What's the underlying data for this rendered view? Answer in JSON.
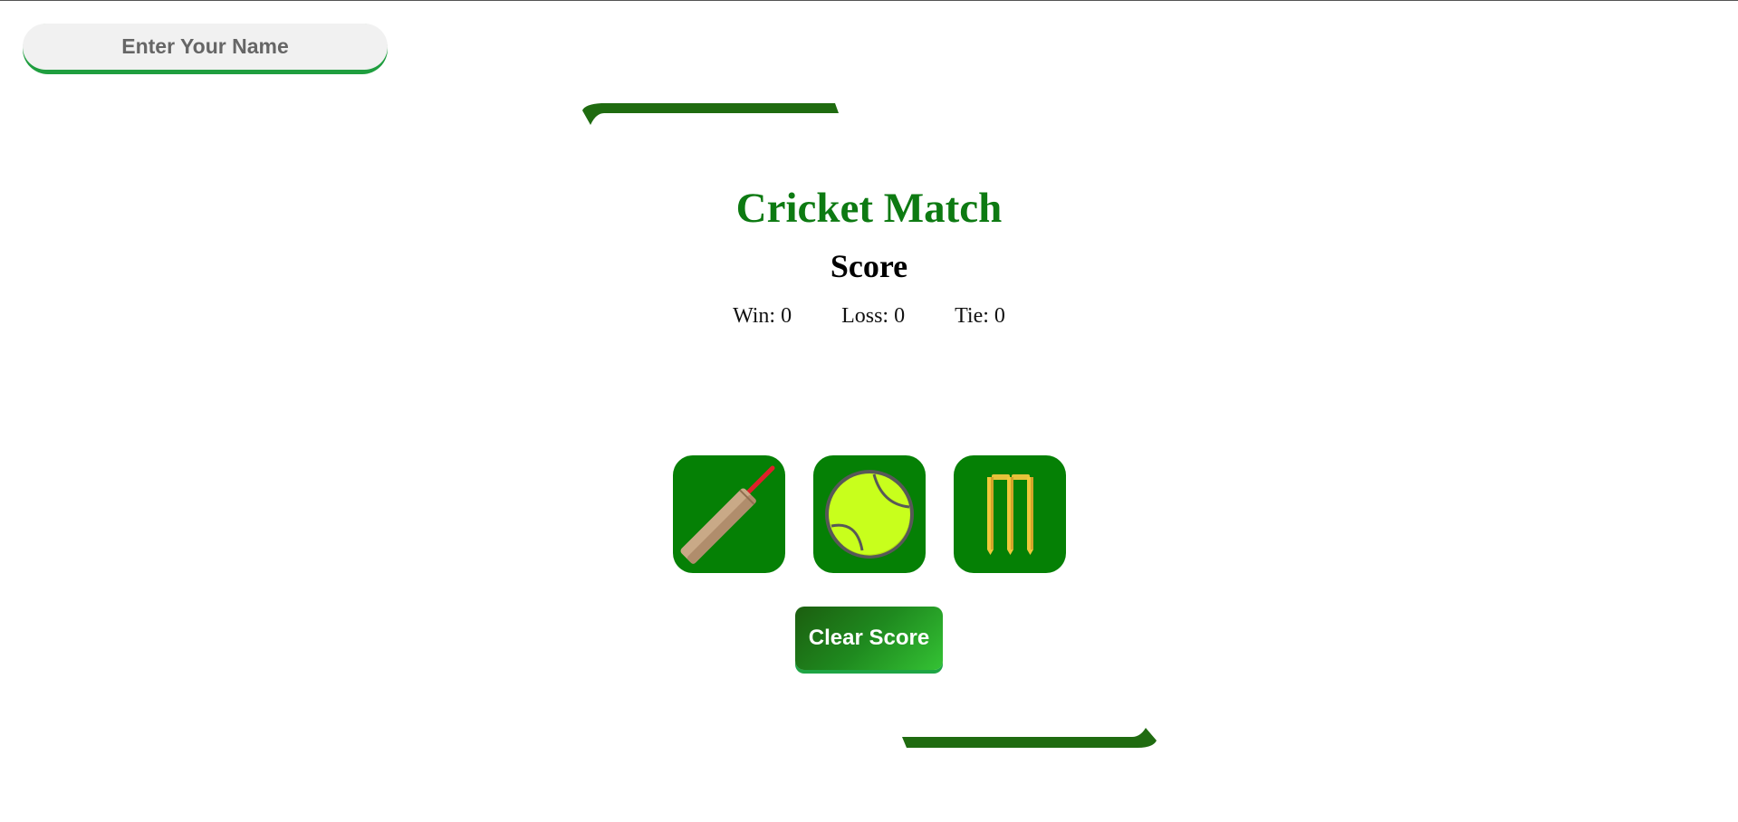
{
  "name_input": {
    "placeholder": "Enter Your Name",
    "value": ""
  },
  "title": "Cricket Match",
  "score": {
    "heading": "Score",
    "win_label": "Win: 0",
    "loss_label": "Loss: 0",
    "tie_label": "Tie: 0"
  },
  "choices": [
    {
      "icon": "bat-icon"
    },
    {
      "icon": "ball-icon"
    },
    {
      "icon": "stumps-icon"
    }
  ],
  "clear_button": {
    "label": "Clear Score"
  },
  "colors": {
    "accent_green": "#058005",
    "title_green": "#0d7a12",
    "ribbon_green": "#1f6b10",
    "input_underline": "#1f9e3f",
    "input_bg": "#f1f1f1"
  }
}
